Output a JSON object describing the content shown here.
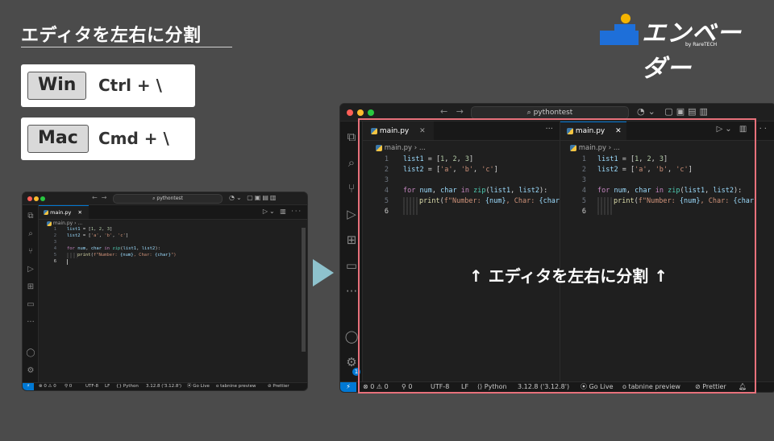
{
  "header": {
    "title": "エディタを左右に分割"
  },
  "brand": {
    "name": "エンベーダー",
    "sub": "by RareTECH",
    "accent": "#1e6fd9"
  },
  "shortcuts": [
    {
      "os": "Win",
      "combo": "Ctrl + \\"
    },
    {
      "os": "Mac",
      "combo": "Cmd + \\"
    }
  ],
  "editor": {
    "search": "pythontest",
    "tab": "main.py",
    "breadcrumb_file": "main.py",
    "breadcrumb_rest": "...",
    "line_numbers": [
      "1",
      "2",
      "3",
      "4",
      "5",
      "6"
    ],
    "code": {
      "l1": [
        "list1",
        " = [",
        "1",
        ", ",
        "2",
        ", ",
        "3",
        "]"
      ],
      "l2": [
        "list2",
        " = [",
        "'a'",
        ", ",
        "'b'",
        ", ",
        "'c'",
        "]"
      ],
      "l4": [
        "for",
        " ",
        "num",
        ", ",
        "char",
        " ",
        "in",
        " ",
        "zip",
        "(",
        "list1",
        ", ",
        "list2",
        "):"
      ],
      "l5": [
        "print",
        "(",
        "f\"Number: ",
        "{num}",
        ", Char: ",
        "{char}",
        "\")"
      ],
      "l5_split": "{char}"
    },
    "status": {
      "errors": "0",
      "warnings": "0",
      "ports": "0",
      "encoding": "UTF-8",
      "eol": "LF",
      "language": "Python",
      "interpreter": "3.12.8 ('3.12.8')",
      "golive": "Go Live",
      "tabnine": "tabnine preview",
      "prettier": "Prettier",
      "badge": "1"
    }
  },
  "overlay": {
    "caption": "↑ エディタを左右に分割 ↑"
  },
  "colors": {
    "highlight": "#e8717b",
    "arrow": "#8ec2cd"
  }
}
